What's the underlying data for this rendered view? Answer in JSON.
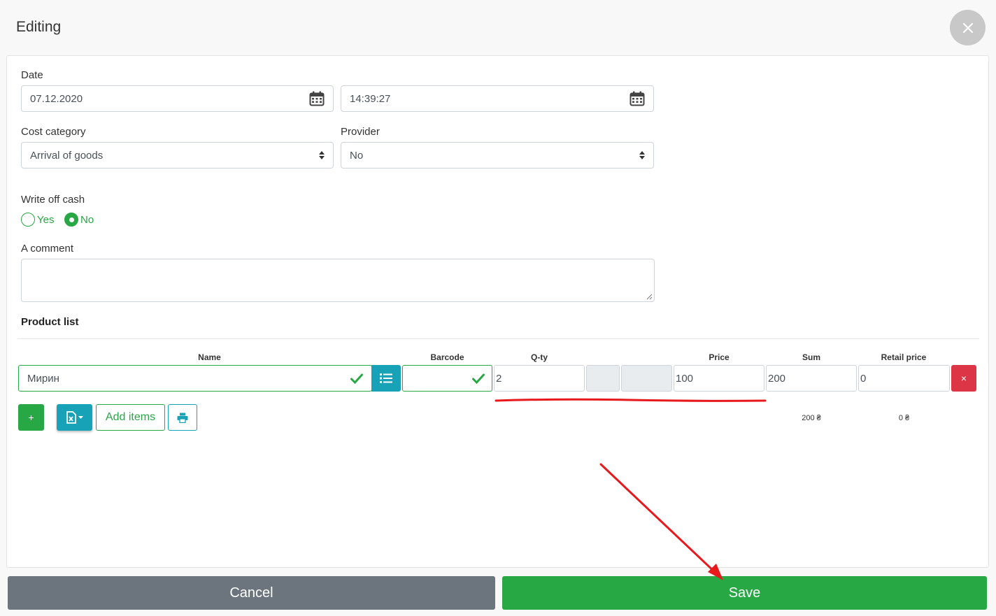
{
  "header": {
    "title": "Editing"
  },
  "form": {
    "date_label": "Date",
    "date_value": "07.12.2020",
    "time_value": "14:39:27",
    "cost_category_label": "Cost category",
    "cost_category_value": "Arrival of goods",
    "provider_label": "Provider",
    "provider_value": "No",
    "write_off_label": "Write off cash",
    "write_off_options": [
      "Yes",
      "No"
    ],
    "write_off_selected": "No",
    "comment_label": "A comment",
    "comment_value": ""
  },
  "products": {
    "title": "Product list",
    "columns": {
      "name": "Name",
      "barcode": "Barcode",
      "qty": "Q-ty",
      "price": "Price",
      "sum": "Sum",
      "retail": "Retail price"
    },
    "rows": [
      {
        "name": "Мирин",
        "barcode": "",
        "qty": "2",
        "price": "100",
        "sum": "200",
        "retail": "0"
      }
    ],
    "delete_label": "×",
    "add_label": "+",
    "add_items_label": "Add items",
    "total_sum": "200 ₴",
    "total_retail": "0 ₴"
  },
  "footer": {
    "cancel_label": "Cancel",
    "save_label": "Save"
  },
  "colors": {
    "green": "#28a745",
    "teal": "#17a2b8",
    "red": "#dc3545",
    "grey": "#6c757d",
    "annotation": "#e8191c"
  },
  "icons": [
    "close-icon",
    "calendar-icon",
    "sort-icon",
    "check-icon",
    "list-icon",
    "excel-icon",
    "print-icon"
  ]
}
